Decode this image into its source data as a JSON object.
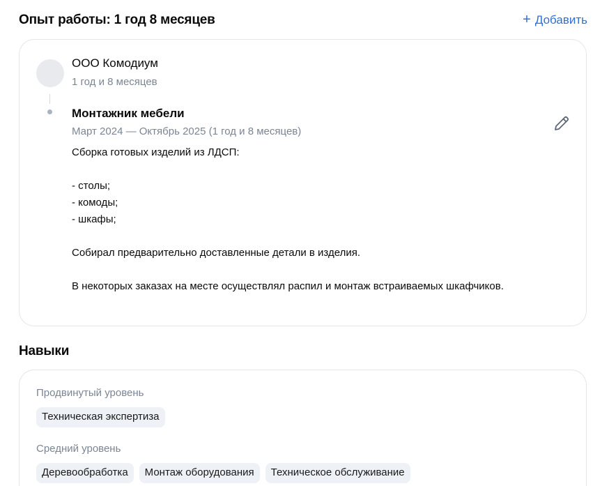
{
  "experience": {
    "title": "Опыт работы: 1 год 8 месяцев",
    "add_label": "Добавить",
    "add_icon": "plus-icon",
    "company": {
      "name": "ООО Комодиум",
      "duration": "1 год и 8 месяцев"
    },
    "position": {
      "title": "Монтажник мебели",
      "dates": "Март 2024 — Октябрь 2025 (1 год и 8 месяцев)",
      "description_lines": [
        "Сборка готовых изделий из ЛДСП:",
        "",
        "- столы;",
        "- комоды;",
        "- шкафы;",
        "",
        "Собирал предварительно доставленные детали в изделия.",
        "",
        "В некоторых заказах на месте осуществлял распил и монтаж встраиваемых шкафчиков."
      ],
      "edit_icon": "pencil-icon"
    }
  },
  "skills": {
    "title": "Навыки",
    "groups": [
      {
        "level": "Продвинутый уровень",
        "items": [
          "Техническая экспертиза"
        ]
      },
      {
        "level": "Средний уровень",
        "items": [
          "Деревообработка",
          "Монтаж оборудования",
          "Техническое обслуживание"
        ]
      }
    ]
  },
  "colors": {
    "accent": "#2f6fd8",
    "muted_text": "#7b8594",
    "tag_background": "#eef1f5",
    "card_border": "#e3e6ea"
  }
}
